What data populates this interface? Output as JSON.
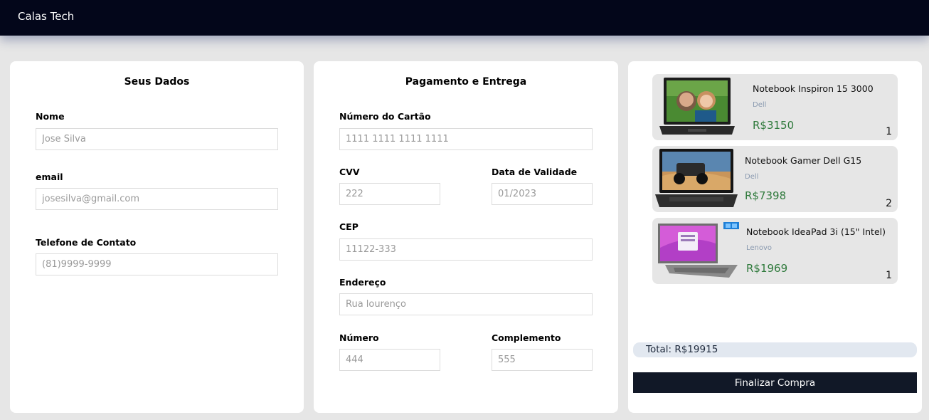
{
  "app": {
    "brand": "Calas Tech"
  },
  "personal": {
    "title": "Seus Dados",
    "name_label": "Nome",
    "name_placeholder": "Jose Silva",
    "email_label": "email",
    "email_placeholder": "josesilva@gmail.com",
    "phone_label": "Telefone de Contato",
    "phone_placeholder": "(81)9999-9999"
  },
  "payment": {
    "title": "Pagamento e Entrega",
    "card_label": "Número do Cartão",
    "card_placeholder": "1111 1111 1111 1111",
    "cvv_label": "CVV",
    "cvv_placeholder": "222",
    "expiry_label": "Data de Validade",
    "expiry_placeholder": "01/2023",
    "cep_label": "CEP",
    "cep_placeholder": "11122-333",
    "address_label": "Endereço",
    "address_placeholder": "Rua lourenço",
    "number_label": "Número",
    "number_placeholder": "444",
    "complement_label": "Complemento",
    "complement_placeholder": "555"
  },
  "cart": {
    "items": [
      {
        "name": "Notebook Inspiron 15 3000",
        "brand": "Dell",
        "price": "R$3150",
        "qty": "1",
        "image": "laptop-photo-selfie"
      },
      {
        "name": "Notebook Gamer Dell G15",
        "brand": "Dell",
        "price": "R$7398",
        "qty": "2",
        "image": "laptop-photo-buggy"
      },
      {
        "name": "Notebook IdeaPad 3i (15\" Intel)",
        "brand": "Lenovo",
        "price": "R$1969",
        "qty": "1",
        "image": "laptop-photo-windows"
      }
    ],
    "total": "Total: R$19915",
    "checkout_label": "Finalizar Compra"
  },
  "colors": {
    "topbar": "#03061a",
    "price": "#2f7a3c",
    "button": "#111827",
    "total_bg": "#e2e8f0"
  }
}
